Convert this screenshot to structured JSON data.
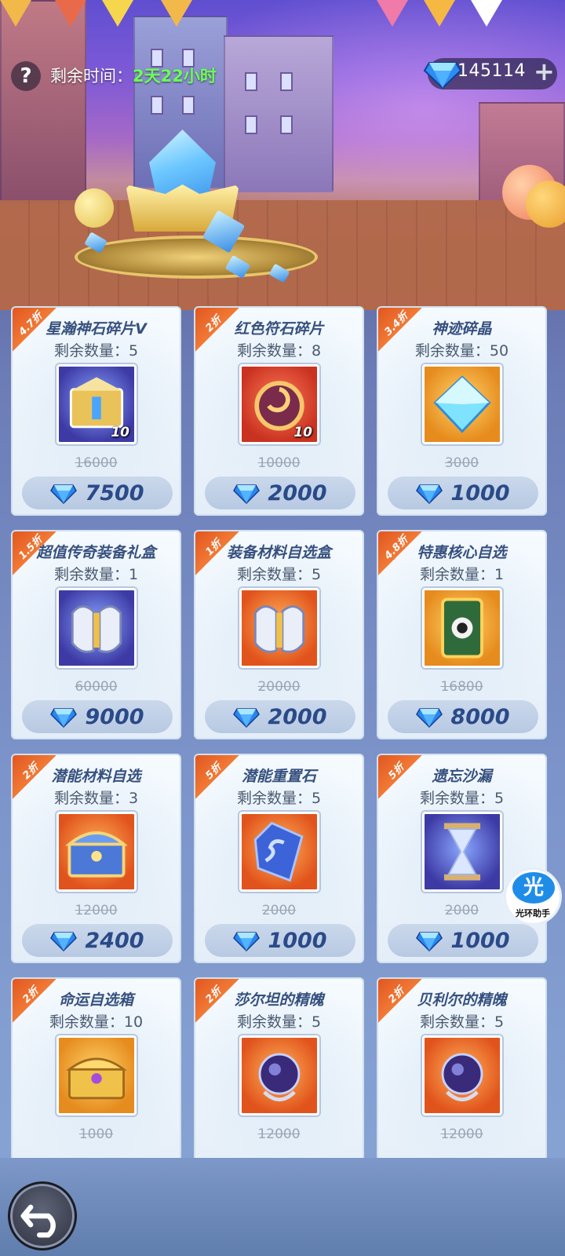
{
  "header": {
    "help_icon": "question-mark-icon",
    "remaining_time_label": "剩余时间：",
    "remaining_time_value": "2天22小时",
    "currency": {
      "icon": "diamond-icon",
      "amount": "145114",
      "plus_icon": "plus-icon"
    }
  },
  "shop": {
    "items": [
      {
        "discount": "4.7折",
        "name": "星瀚神石碎片V",
        "stock": "剩余数量：5",
        "icon": "treasure-chest-icon",
        "frame": "purple",
        "qty": "10",
        "original_price": "16000",
        "price": "7500"
      },
      {
        "discount": "2折",
        "name": "红色符石碎片",
        "stock": "剩余数量：8",
        "icon": "rune-stone-icon",
        "frame": "red",
        "qty": "10",
        "original_price": "10000",
        "price": "2000"
      },
      {
        "discount": "3.4折",
        "name": "神迹碎晶",
        "stock": "剩余数量：50",
        "icon": "crystal-icon",
        "frame": "gold",
        "qty": "",
        "original_price": "3000",
        "price": "1000"
      },
      {
        "discount": "1.5折",
        "name": "超值传奇装备礼盒",
        "stock": "剩余数量：1",
        "icon": "armor-box-icon",
        "frame": "purple",
        "qty": "",
        "original_price": "60000",
        "price": "9000"
      },
      {
        "discount": "1折",
        "name": "装备材料自选盒",
        "stock": "剩余数量：5",
        "icon": "armor-box-icon",
        "frame": "orange",
        "qty": "",
        "original_price": "20000",
        "price": "2000"
      },
      {
        "discount": "4.8折",
        "name": "特惠核心自选",
        "stock": "剩余数量：1",
        "icon": "card-icon",
        "frame": "gold",
        "qty": "",
        "original_price": "16800",
        "price": "8000"
      },
      {
        "discount": "2折",
        "name": "潜能材料自选",
        "stock": "剩余数量：3",
        "icon": "chest-icon",
        "frame": "orange",
        "qty": "",
        "original_price": "12000",
        "price": "2400"
      },
      {
        "discount": "5折",
        "name": "潜能重置石",
        "stock": "剩余数量：5",
        "icon": "blue-stone-icon",
        "frame": "orange",
        "qty": "",
        "original_price": "2000",
        "price": "1000"
      },
      {
        "discount": "5折",
        "name": "遗忘沙漏",
        "stock": "剩余数量：5",
        "icon": "hourglass-icon",
        "frame": "purple",
        "qty": "",
        "original_price": "2000",
        "price": "1000"
      },
      {
        "discount": "2折",
        "name": "命运自选箱",
        "stock": "剩余数量：10",
        "icon": "golden-chest-icon",
        "frame": "gold",
        "qty": "",
        "original_price": "1000",
        "price": ""
      },
      {
        "discount": "2折",
        "name": "莎尔坦的精魄",
        "stock": "剩余数量：5",
        "icon": "spirit-orb-icon",
        "frame": "orange",
        "qty": "",
        "original_price": "12000",
        "price": ""
      },
      {
        "discount": "2折",
        "name": "贝利尔的精魄",
        "stock": "剩余数量：5",
        "icon": "spirit-orb-icon",
        "frame": "orange",
        "qty": "",
        "original_price": "12000",
        "price": ""
      }
    ]
  },
  "helper_widget": {
    "glyph": "光",
    "label": "光环助手"
  },
  "footer": {
    "back_icon": "back-arrow-icon"
  }
}
